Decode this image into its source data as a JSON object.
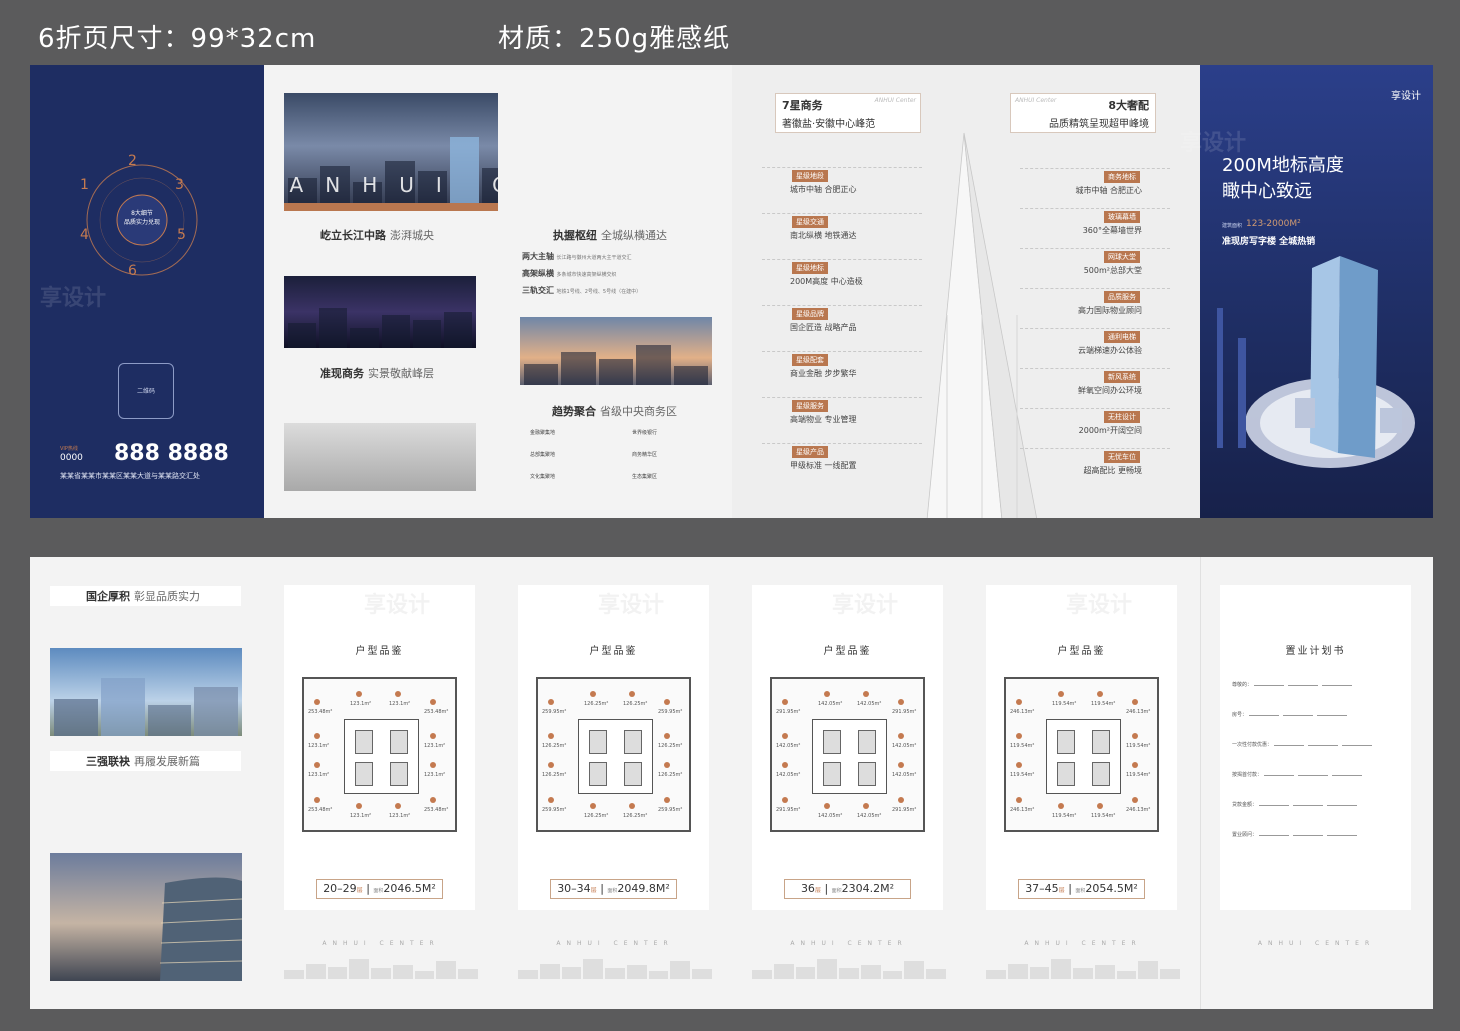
{
  "header": {
    "size_label": "6折页尺寸：99*32cm",
    "material_label": "材质：250g雅感纸"
  },
  "colors": {
    "navy": "#1e2d62",
    "copper": "#b9774f"
  },
  "watermark": "享设计",
  "cover_left": {
    "circle_center": "8大细节\n品质实力兑现",
    "numbers": [
      "1",
      "2",
      "3",
      "4",
      "5",
      "6"
    ],
    "qr_label": "二维码",
    "vip_label": "VIP热线",
    "phone_prefix": "0000",
    "phone": "888 8888",
    "address": "某某省某某市某某区某某大道与某某路交汇处"
  },
  "panel2": {
    "photo_text": "ANHUI CENTER",
    "sec1_bold": "屹立长江中路",
    "sec1_sub": "澎湃城央",
    "sec2_bold": "准现商务",
    "sec2_sub": "实景敬献峰层"
  },
  "panel3": {
    "sec1_bold": "执握枢纽",
    "sec1_sub": "全城纵横通达",
    "items": [
      {
        "k": "两大主轴",
        "v": "长江路与徽州大道两大主干道交汇"
      },
      {
        "k": "高架纵横",
        "v": "多条城市快速高架纵横交织"
      },
      {
        "k": "三轨交汇",
        "v": "地铁1号线、2号线、5号线（在建中）"
      }
    ],
    "sec2_bold": "趋势聚合",
    "sec2_sub": "省级中央商务区",
    "grid": [
      "金融聚集地",
      "世界级银行",
      "总部集聚地",
      "商务精华区",
      "文化集聚地",
      "生态集聚区"
    ]
  },
  "panel4": {
    "box_title": "7星商务",
    "box_sub": "著徽盐·安徽中心峰范",
    "box_en": "ANHUI Center",
    "tags": [
      {
        "tag": "星级地段",
        "line": "城市中轴 合肥正心"
      },
      {
        "tag": "星级交通",
        "line": "南北纵横 地铁通达"
      },
      {
        "tag": "星级地标",
        "line": "200M高度 中心造极"
      },
      {
        "tag": "星级品牌",
        "line": "国企匠造 战略产品"
      },
      {
        "tag": "星级配套",
        "line": "商业金融 步步繁华"
      },
      {
        "tag": "星级服务",
        "line": "高端物业 专业管理"
      },
      {
        "tag": "星级产品",
        "line": "甲级标准 一线配置"
      }
    ]
  },
  "panel5": {
    "box_title": "8大奢配",
    "box_sub": "品质精筑呈现超甲峰境",
    "box_en": "ANHUI Center",
    "tags": [
      {
        "tag": "商务地标",
        "line": "城市中轴 合肥正心"
      },
      {
        "tag": "玻璃幕墙",
        "line": "360°全幕墙世界"
      },
      {
        "tag": "网球大堂",
        "line": "500m²总部大堂"
      },
      {
        "tag": "品质服务",
        "line": "高力国际物业顾问"
      },
      {
        "tag": "通利电梯",
        "line": "云端梯速办公体验"
      },
      {
        "tag": "新风系统",
        "line": "鲜氧空间办公环境"
      },
      {
        "tag": "无柱设计",
        "line": "2000m²开阔空间"
      },
      {
        "tag": "无忧车位",
        "line": "超高配比 更畅境"
      }
    ]
  },
  "cover_right": {
    "logo": "享设计",
    "headline1": "200M地标高度",
    "headline2": "瞰中心致远",
    "area_label": "建筑面积",
    "area_value": "123-2000M²",
    "cta": "准现房写字楼 全城热销"
  },
  "sheet2": {
    "intro_sec1_bold": "国企厚积",
    "intro_sec1_sub": "彰显品质实力",
    "intro_sec2_bold": "三强联袂",
    "intro_sec2_sub": "再履发展新篇",
    "plan_title": "户型品鉴",
    "footer": "ANHUI CENTER",
    "plans": [
      {
        "floors": "20–29",
        "unit": "层",
        "area_label": "面积",
        "area": "2046.5M²",
        "rooms": [
          "253.48m²",
          "123.1m²",
          "123.1m²",
          "253.48m²"
        ]
      },
      {
        "floors": "30–34",
        "unit": "层",
        "area_label": "面积",
        "area": "2049.8M²",
        "rooms": [
          "259.95m²",
          "126.25m²",
          "126.25m²",
          "259.95m²"
        ]
      },
      {
        "floors": "36",
        "unit": "层",
        "area_label": "面积",
        "area": "2304.2M²",
        "rooms": [
          "291.95m²",
          "142.05m²",
          "142.05m²",
          "291.95m²"
        ]
      },
      {
        "floors": "37–45",
        "unit": "层",
        "area_label": "面积",
        "area": "2054.5M²",
        "rooms": [
          "246.13m²",
          "119.54m²",
          "119.54m²",
          "246.13m²"
        ]
      }
    ],
    "plan_book_title": "置业计划书",
    "form": [
      "尊敬的：",
      "房号：",
      "一次性付款优惠：",
      "按揭首付款：",
      "贷款金额：",
      "置业顾问："
    ]
  }
}
